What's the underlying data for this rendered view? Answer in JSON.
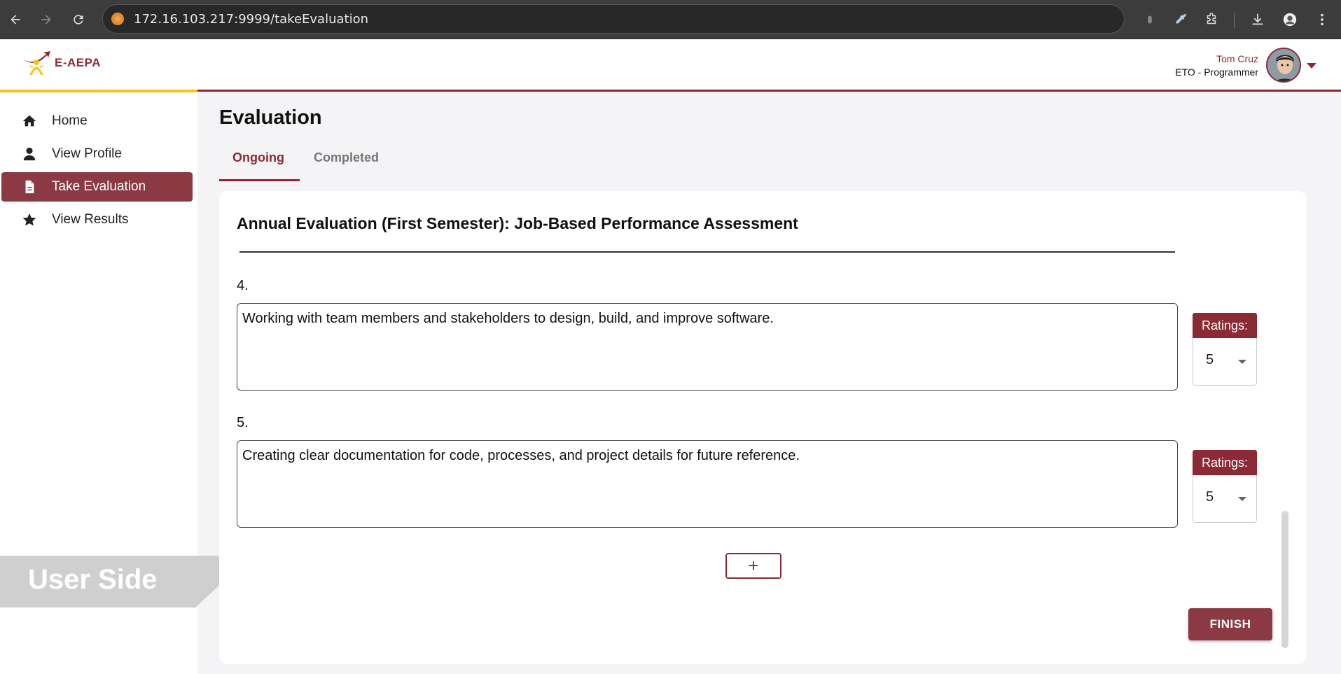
{
  "browser": {
    "url": "172.16.103.217:9999/takeEvaluation"
  },
  "header": {
    "logo_text": "E-AEPA",
    "user_name": "Tom Cruz",
    "user_role": "ETO - Programmer"
  },
  "sidebar": {
    "items": [
      {
        "label": "Home",
        "icon": "home-icon",
        "active": false
      },
      {
        "label": "View Profile",
        "icon": "user-icon",
        "active": false
      },
      {
        "label": "Take Evaluation",
        "icon": "document-icon",
        "active": true
      },
      {
        "label": "View Results",
        "icon": "star-icon",
        "active": false
      }
    ]
  },
  "watermark": "User Side",
  "main": {
    "title": "Evaluation",
    "tabs": [
      {
        "label": "Ongoing",
        "active": true
      },
      {
        "label": "Completed",
        "active": false
      }
    ],
    "card_title": "Annual Evaluation (First Semester): Job-Based Performance Assessment",
    "questions": [
      {
        "number": "4.",
        "text": "Working with team members and stakeholders to design, build, and improve software.",
        "rating_label": "Ratings:",
        "rating": "5"
      },
      {
        "number": "5.",
        "text": "Creating clear documentation for code, processes, and project details for future reference.",
        "rating_label": "Ratings:",
        "rating": "5"
      }
    ],
    "add_label": "+",
    "finish_label": "FINISH"
  },
  "colors": {
    "accent": "#8b2a35",
    "accent_yellow": "#f5c518"
  }
}
